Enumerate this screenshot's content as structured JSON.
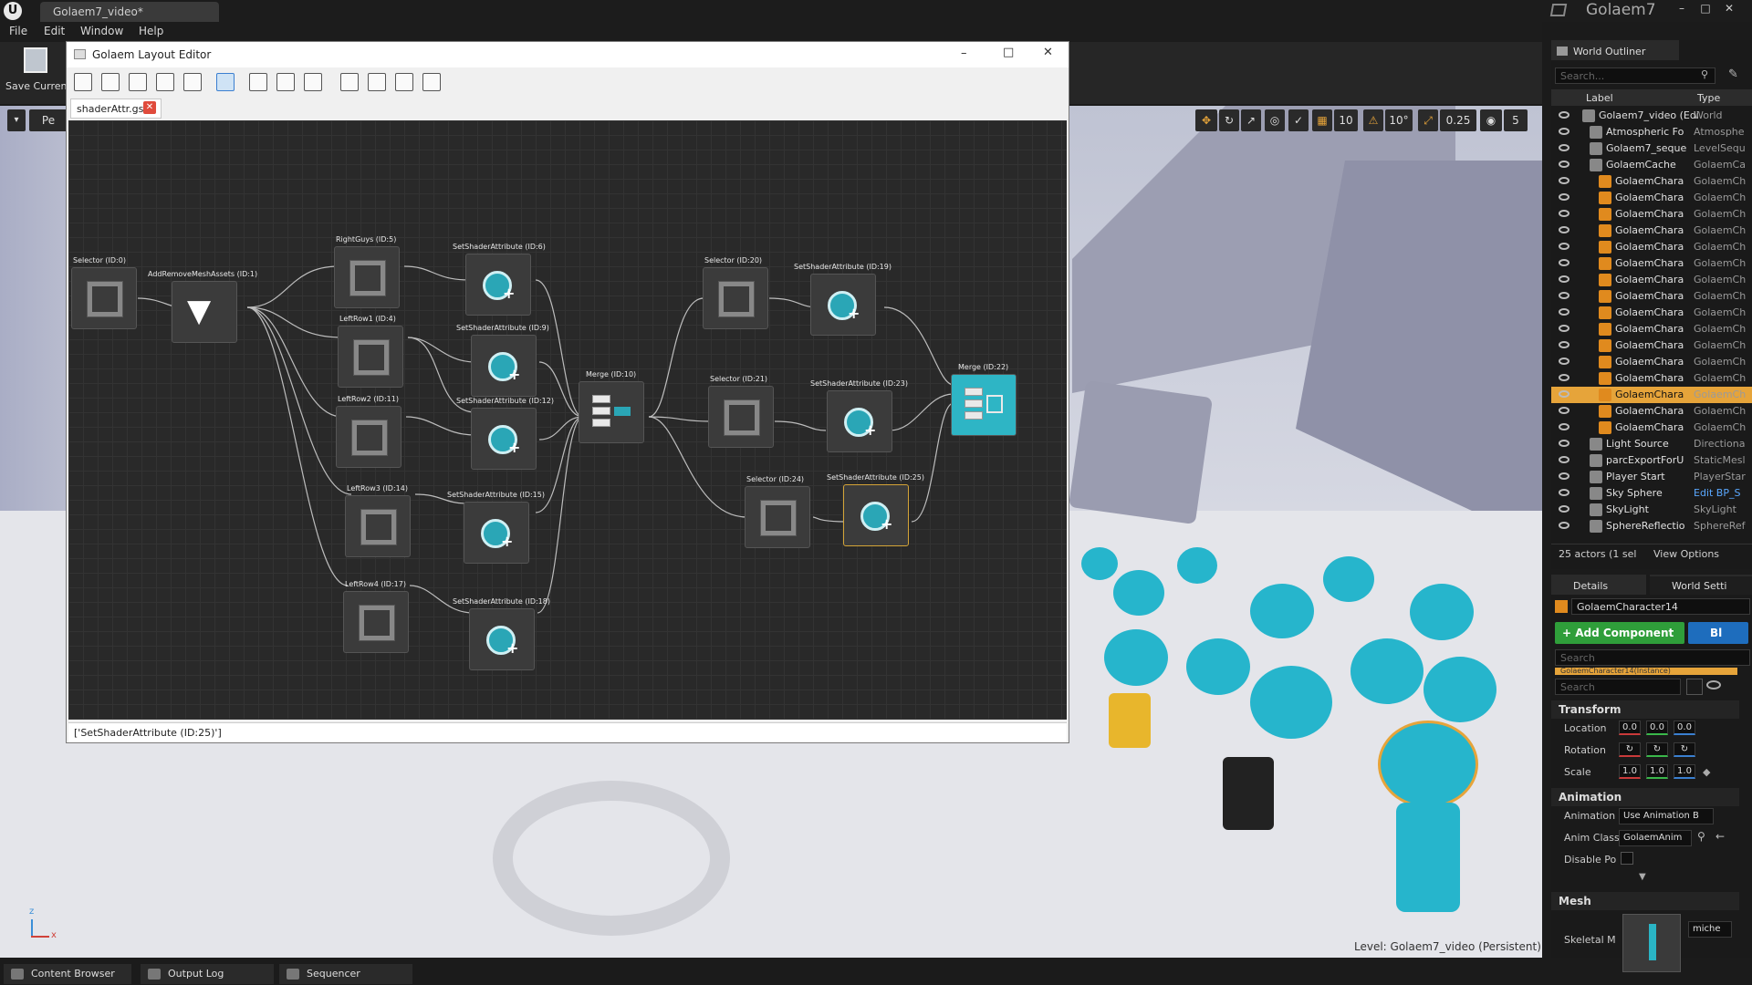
{
  "window": {
    "doc_tab": "Golaem7_video*",
    "project": "Golaem7"
  },
  "menu": [
    "File",
    "Edit",
    "Window",
    "Help"
  ],
  "toolbar": {
    "save_label": "Save Curren"
  },
  "viewport": {
    "left_btn": "Pe",
    "snap_angle": "10°",
    "grid_size": "10",
    "scale_snap": "0.25",
    "cam_speed": "5",
    "level_text": "Level:  Golaem7_video (Persistent)"
  },
  "editor": {
    "title": "Golaem Layout Editor",
    "file_tab": "shaderAttr.gscl",
    "status": "['SetShaderAttribute (ID:25)']",
    "nodes": [
      {
        "id": "Selector (ID:0)",
        "kind": "selector"
      },
      {
        "id": "AddRemoveMeshAssets (ID:1)",
        "kind": "mesh"
      },
      {
        "id": "RightGuys (ID:5)",
        "kind": "selector"
      },
      {
        "id": "LeftRow1 (ID:4)",
        "kind": "selector"
      },
      {
        "id": "LeftRow2 (ID:11)",
        "kind": "selector"
      },
      {
        "id": "LeftRow3 (ID:14)",
        "kind": "selector"
      },
      {
        "id": "LeftRow4 (ID:17)",
        "kind": "selector"
      },
      {
        "id": "SetShaderAttribute (ID:6)",
        "kind": "shader"
      },
      {
        "id": "SetShaderAttribute (ID:9)",
        "kind": "shader"
      },
      {
        "id": "SetShaderAttribute (ID:12)",
        "kind": "shader"
      },
      {
        "id": "SetShaderAttribute (ID:15)",
        "kind": "shader"
      },
      {
        "id": "SetShaderAttribute (ID:18)",
        "kind": "shader"
      },
      {
        "id": "Merge (ID:10)",
        "kind": "merge"
      },
      {
        "id": "Selector (ID:20)",
        "kind": "selector"
      },
      {
        "id": "Selector (ID:21)",
        "kind": "selector"
      },
      {
        "id": "Selector (ID:24)",
        "kind": "selector"
      },
      {
        "id": "SetShaderAttribute (ID:19)",
        "kind": "shader"
      },
      {
        "id": "SetShaderAttribute (ID:23)",
        "kind": "shader"
      },
      {
        "id": "SetShaderAttribute (ID:25)",
        "kind": "shader"
      },
      {
        "id": "Merge (ID:22)",
        "kind": "merge"
      }
    ]
  },
  "outliner": {
    "tab": "World Outliner",
    "search_placeholder": "Search...",
    "col_label": "Label",
    "col_type": "Type",
    "rows": [
      {
        "label": "Golaem7_video (Edi",
        "type": "World"
      },
      {
        "label": "Atmospheric Fo",
        "type": "Atmosphe"
      },
      {
        "label": "Golaem7_seque",
        "type": "LevelSequ"
      },
      {
        "label": "GolaemCache",
        "type": "GolaemCa"
      },
      {
        "label": "GolaemChara",
        "type": "GolaemCh"
      },
      {
        "label": "GolaemChara",
        "type": "GolaemCh"
      },
      {
        "label": "GolaemChara",
        "type": "GolaemCh"
      },
      {
        "label": "GolaemChara",
        "type": "GolaemCh"
      },
      {
        "label": "GolaemChara",
        "type": "GolaemCh"
      },
      {
        "label": "GolaemChara",
        "type": "GolaemCh"
      },
      {
        "label": "GolaemChara",
        "type": "GolaemCh"
      },
      {
        "label": "GolaemChara",
        "type": "GolaemCh"
      },
      {
        "label": "GolaemChara",
        "type": "GolaemCh"
      },
      {
        "label": "GolaemChara",
        "type": "GolaemCh"
      },
      {
        "label": "GolaemChara",
        "type": "GolaemCh"
      },
      {
        "label": "GolaemChara",
        "type": "GolaemCh"
      },
      {
        "label": "GolaemChara",
        "type": "GolaemCh"
      },
      {
        "label": "GolaemChara",
        "type": "GolaemCh"
      },
      {
        "label": "GolaemChara",
        "type": "GolaemCh"
      },
      {
        "label": "GolaemChara",
        "type": "GolaemCh"
      },
      {
        "label": "Light Source",
        "type": "Directiona"
      },
      {
        "label": "parcExportForU",
        "type": "StaticMesl"
      },
      {
        "label": "Player Start",
        "type": "PlayerStar"
      },
      {
        "label": "Sky Sphere",
        "type": "Edit BP_S"
      },
      {
        "label": "SkyLight",
        "type": "SkyLight"
      },
      {
        "label": "SphereReflectio",
        "type": "SphereRef"
      }
    ],
    "footer": "25 actors (1 sel",
    "view_options": "View Options"
  },
  "details": {
    "tab": "Details",
    "tab2": "World Setti",
    "actor_name": "GolaemCharacter14",
    "add_component": "+ Add Component",
    "bp_button": "Bl",
    "search_placeholder": "Search",
    "instance_row": "GolaemCharacter14(Instance)",
    "search2_placeholder": "Search",
    "transform": "Transform",
    "location": "Location",
    "rotation": "Rotation",
    "scale": "Scale",
    "loc": [
      "0.0",
      "0.0",
      "0.0"
    ],
    "scl": [
      "1.0",
      "1.0",
      "1.0"
    ],
    "animation_section": "Animation",
    "animation_label": "Animation",
    "animation_value": "Use Animation B",
    "anim_class_label": "Anim Class",
    "anim_class_value": "GolaemAnim",
    "disable_label": "Disable Po",
    "mesh_section": "Mesh",
    "skeletal_label": "Skeletal M",
    "mesh_combo": "miche"
  },
  "bottom": {
    "tabs": [
      "Content Browser",
      "Output Log",
      "Sequencer"
    ]
  }
}
